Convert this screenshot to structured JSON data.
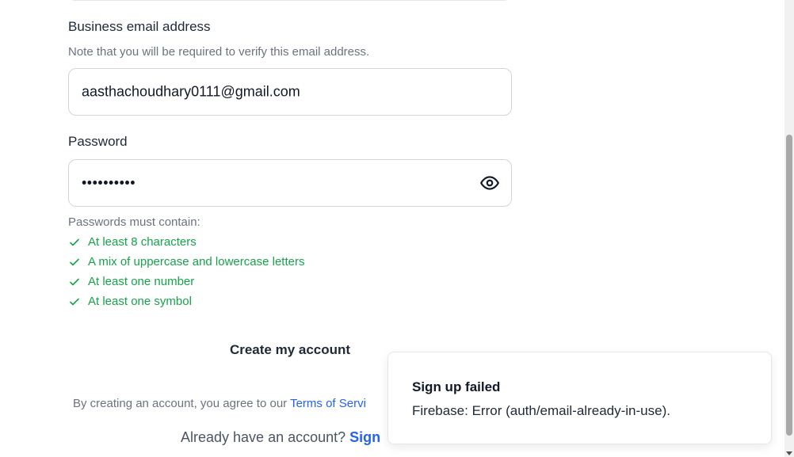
{
  "email": {
    "label": "Business email address",
    "hint": "Note that you will be required to verify this email address.",
    "value": "aasthachoudhary0111@gmail.com"
  },
  "password": {
    "label": "Password",
    "value": "••••••••••",
    "toggle_icon": "eye-icon"
  },
  "requirements": {
    "title": "Passwords must contain:",
    "items": [
      "At least 8 characters",
      "A mix of uppercase and lowercase letters",
      "At least one number",
      "At least one symbol"
    ],
    "color": "#16a34a"
  },
  "create_button": "Create my account",
  "terms": {
    "prefix": "By creating an account, you agree to our ",
    "link": "Terms of Servi"
  },
  "signin": {
    "prefix": "Already have an account? ",
    "link": "Sign"
  },
  "toast": {
    "title": "Sign up failed",
    "message": "Firebase: Error (auth/email-already-in-use)."
  },
  "colors": {
    "link": "#2563eb",
    "success": "#16a34a"
  }
}
